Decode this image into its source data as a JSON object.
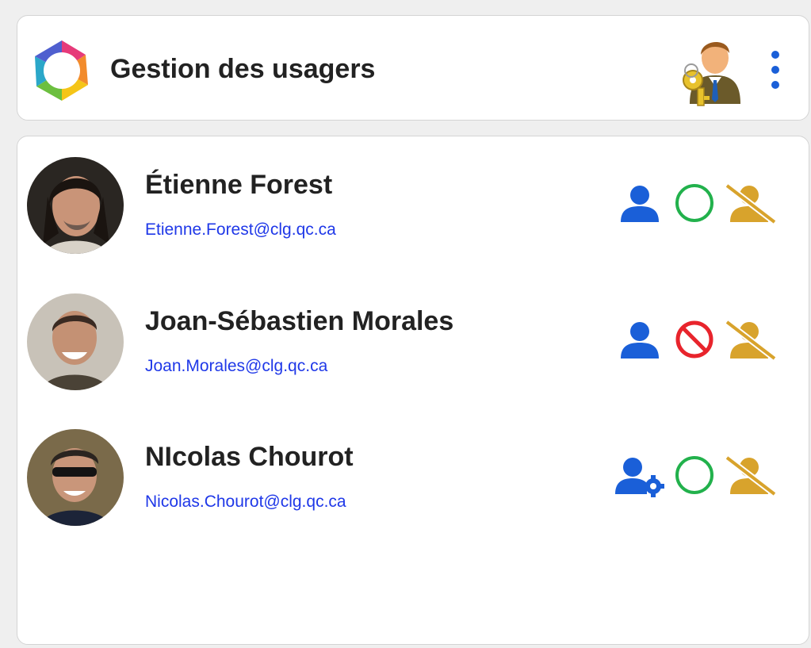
{
  "header": {
    "title": "Gestion des usagers",
    "logo_icon": "aperture-logo-icon",
    "admin_icon": "user-with-key-icon",
    "menu_icon": "vertical-dots-menu-icon"
  },
  "colors": {
    "role_blue": "#1a5fd8",
    "active_green": "#22b14c",
    "blocked_red": "#e8242c",
    "disabled_gold": "#d8a32c",
    "email_blue": "#1f38e8"
  },
  "users": [
    {
      "name": "Étienne Forest",
      "email": "Etienne.Forest@clg.qc.ca",
      "role_icon": "user-icon",
      "status_icon": "active-circle-icon",
      "disable_icon": "user-slash-icon"
    },
    {
      "name": "Joan-Sébastien Morales",
      "email": "Joan.Morales@clg.qc.ca",
      "role_icon": "user-icon",
      "status_icon": "blocked-icon",
      "disable_icon": "user-slash-icon"
    },
    {
      "name": "NIcolas Chourot",
      "email": "Nicolas.Chourot@clg.qc.ca",
      "role_icon": "user-gear-icon",
      "status_icon": "active-circle-icon",
      "disable_icon": "user-slash-icon"
    }
  ]
}
